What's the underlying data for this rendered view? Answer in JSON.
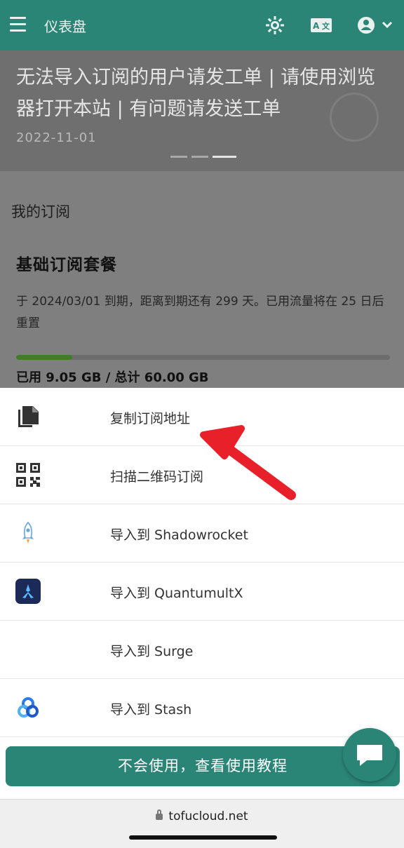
{
  "header": {
    "title": "仪表盘",
    "icons": [
      "menu-icon",
      "theme-toggle-icon",
      "language-icon",
      "user-account-icon",
      "chevron-down-icon"
    ]
  },
  "banner": {
    "text": "无法导入订阅的用户请发工单 | 请使用浏览器打开本站 | 有问题请发送工单",
    "date": "2022-11-01",
    "slide_count": 3,
    "active_slide": 3
  },
  "subscription": {
    "section_title": "我的订阅",
    "plan_name": "基础订阅套餐",
    "description": "于 2024/03/01 到期，距离到期还有 299 天。已用流量将在 25 日后重置",
    "usage_text": "已用 9.05 GB / 总计 60.00 GB",
    "usage_fraction": 0.151
  },
  "sheet": {
    "items": [
      {
        "label": "复制订阅地址",
        "icon": "copy-icon"
      },
      {
        "label": "扫描二维码订阅",
        "icon": "qr-code-icon"
      },
      {
        "label": "导入到 Shadowrocket",
        "icon": "shadowrocket-icon"
      },
      {
        "label": "导入到 QuantumultX",
        "icon": "quantumultx-icon"
      },
      {
        "label": "导入到 Surge",
        "icon": "surge-icon"
      },
      {
        "label": "导入到 Stash",
        "icon": "stash-icon"
      }
    ],
    "tutorial_button": "不会使用，查看使用教程"
  },
  "browser": {
    "url": "tofucloud.net"
  },
  "colors": {
    "brand": "#2b8577",
    "annotation_arrow": "#e8202a"
  }
}
